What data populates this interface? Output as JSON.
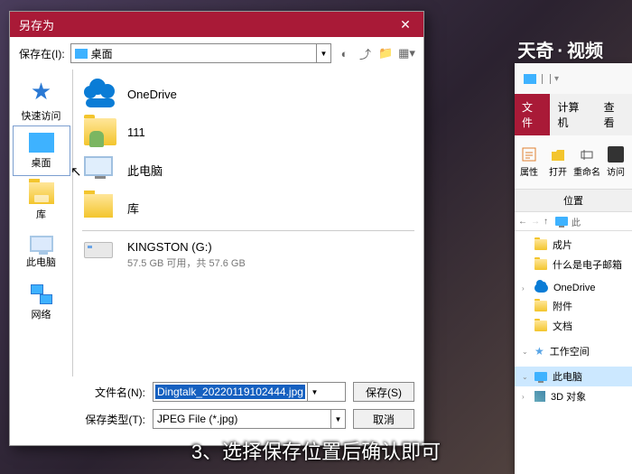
{
  "watermark": {
    "a": "天奇",
    "b": "·",
    "c": "视频"
  },
  "dialog": {
    "title": "另存为",
    "close": "✕",
    "savein_label": "保存在(I):",
    "savein_value": "桌面",
    "sidebar": [
      {
        "id": "quick",
        "label": "快速访问"
      },
      {
        "id": "desktop",
        "label": "桌面"
      },
      {
        "id": "libs",
        "label": "库"
      },
      {
        "id": "thispc",
        "label": "此电脑"
      },
      {
        "id": "network",
        "label": "网络"
      }
    ],
    "files": [
      {
        "id": "onedrive",
        "label": "OneDrive"
      },
      {
        "id": "user111",
        "label": "111"
      },
      {
        "id": "thispc",
        "label": "此电脑"
      },
      {
        "id": "libs",
        "label": "库"
      },
      {
        "id": "kingston",
        "label": "KINGSTON (G:)",
        "sub": "57.5 GB 可用，共 57.6 GB"
      }
    ],
    "filename_label": "文件名(N):",
    "filename_value": "Dingtalk_20220119102444.jpg",
    "filetype_label": "保存类型(T):",
    "filetype_value": "JPEG File (*.jpg)",
    "save_btn": "保存(S)",
    "cancel_btn": "取消"
  },
  "explorer": {
    "tabs": {
      "file": "文件",
      "computer": "计算机",
      "view": "查看"
    },
    "ribbon": {
      "prop": "属性",
      "open": "打开",
      "rename": "重命名",
      "visit": "访问"
    },
    "location_label": "位置",
    "nav_text": "此",
    "tree": [
      {
        "label": "成片"
      },
      {
        "label": "什么是电子邮箱"
      },
      {
        "label": "OneDrive",
        "type": "cloud"
      },
      {
        "label": "附件"
      },
      {
        "label": "文档"
      },
      {
        "label": "工作空间",
        "type": "star"
      },
      {
        "label": "此电脑",
        "type": "pc",
        "sel": true
      },
      {
        "label": "3D 对象",
        "type": "3d"
      }
    ]
  },
  "subtitle": "3、选择保存位置后确认即可"
}
